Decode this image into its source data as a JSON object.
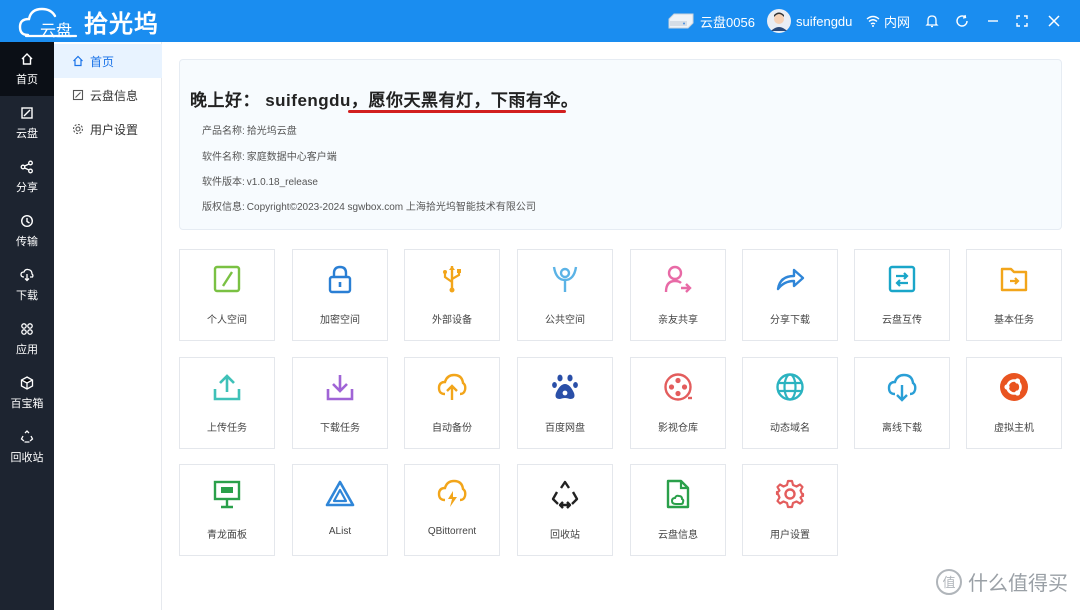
{
  "app": {
    "logo_small": "云盘",
    "logo_name": "拾光坞"
  },
  "topbar": {
    "device": "云盘0056",
    "username": "suifengdu",
    "network": "内网"
  },
  "sidebar": [
    {
      "label": "首页",
      "icon": "home-icon"
    },
    {
      "label": "云盘",
      "icon": "cloud-disk-icon"
    },
    {
      "label": "分享",
      "icon": "share-icon"
    },
    {
      "label": "传输",
      "icon": "transfer-icon"
    },
    {
      "label": "下载",
      "icon": "download-cloud-icon"
    },
    {
      "label": "应用",
      "icon": "apps-icon"
    },
    {
      "label": "百宝箱",
      "icon": "toolbox-icon"
    },
    {
      "label": "回收站",
      "icon": "recycle-icon"
    }
  ],
  "subnav": [
    {
      "label": "首页",
      "icon": "home-icon"
    },
    {
      "label": "云盘信息",
      "icon": "cloud-disk-icon"
    },
    {
      "label": "用户设置",
      "icon": "gear-icon"
    }
  ],
  "welcome": {
    "greeting": "晚上好：  suifengdu，愿你天黑有灯，下雨有伞。",
    "rows": [
      {
        "key": "产品名称:",
        "value": "拾光坞云盘"
      },
      {
        "key": "软件名称:",
        "value": "家庭数据中心客户端"
      },
      {
        "key": "软件版本:",
        "value": "v1.0.18_release"
      },
      {
        "key": "版权信息:",
        "value": "Copyright©2023-2024 sgwbox.com 上海拾光坞智能技术有限公司"
      }
    ]
  },
  "tiles": [
    {
      "label": "个人空间",
      "icon": "personal-space-icon"
    },
    {
      "label": "加密空间",
      "icon": "lock-icon"
    },
    {
      "label": "外部设备",
      "icon": "usb-icon"
    },
    {
      "label": "公共空间",
      "icon": "public-space-icon"
    },
    {
      "label": "亲友共享",
      "icon": "user-share-icon"
    },
    {
      "label": "分享下载",
      "icon": "share-arrow-icon"
    },
    {
      "label": "云盘互传",
      "icon": "transfer-icon"
    },
    {
      "label": "基本任务",
      "icon": "folder-task-icon"
    },
    {
      "label": "上传任务",
      "icon": "upload-icon"
    },
    {
      "label": "下载任务",
      "icon": "download-icon"
    },
    {
      "label": "自动备份",
      "icon": "cloud-upload-icon"
    },
    {
      "label": "百度网盘",
      "icon": "baidu-paw-icon"
    },
    {
      "label": "影视仓库",
      "icon": "film-reel-icon"
    },
    {
      "label": "动态域名",
      "icon": "globe-icon"
    },
    {
      "label": "离线下载",
      "icon": "cloud-download-icon"
    },
    {
      "label": "虚拟主机",
      "icon": "ubuntu-icon"
    },
    {
      "label": "青龙面板",
      "icon": "board-icon"
    },
    {
      "label": "AList",
      "icon": "alist-triangle-icon"
    },
    {
      "label": "QBittorrent",
      "icon": "cloud-lightning-icon"
    },
    {
      "label": "回收站",
      "icon": "recycle-icon"
    },
    {
      "label": "云盘信息",
      "icon": "file-cloud-icon"
    },
    {
      "label": "用户设置",
      "icon": "gear-icon"
    }
  ],
  "watermark": {
    "symbol": "值",
    "text": "什么值得买"
  },
  "colors": {
    "topbar": "#1a8df0",
    "sidebar": "#1d2430",
    "accent": "#1a73e8",
    "underline": "#d21f1f"
  }
}
